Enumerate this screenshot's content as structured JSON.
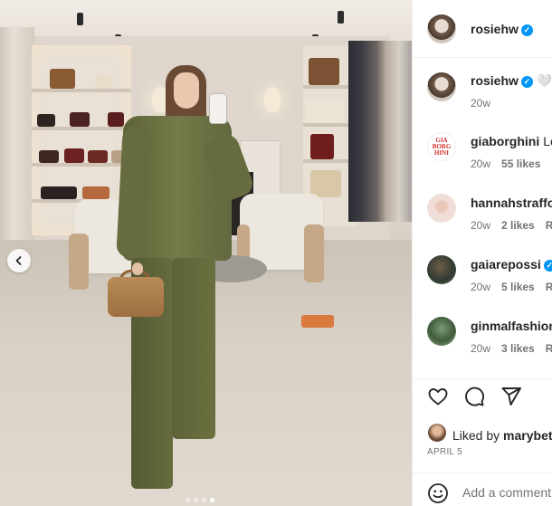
{
  "photo": {
    "alt": "",
    "carousel": {
      "count": 4,
      "active": 3
    }
  },
  "header": {
    "username": "rosiehw",
    "verified": true
  },
  "caption": {
    "username": "rosiehw",
    "verified": true,
    "text": "🤍🤍",
    "age": "20w"
  },
  "comments": [
    {
      "username": "giaborghini",
      "text": "Lo",
      "age": "20w",
      "likes": "55 likes",
      "reply": "R",
      "verified": false,
      "avatar_text": "GIA BORG HINI"
    },
    {
      "username": "hannahstraffo",
      "text": "",
      "age": "20w",
      "likes": "2 likes",
      "reply": "R",
      "verified": false
    },
    {
      "username": "gaiarepossi",
      "text": "",
      "age": "20w",
      "likes": "5 likes",
      "reply": "R",
      "verified": true
    },
    {
      "username": "ginmalfashion",
      "text": "",
      "age": "20w",
      "likes": "3 likes",
      "reply": "R",
      "verified": false
    }
  ],
  "actions": {
    "like_icon": "heart-icon",
    "comment_icon": "comment-bubble-icon",
    "share_icon": "paper-plane-icon"
  },
  "likes": {
    "prefix": "Liked by ",
    "user": "marybet"
  },
  "date": "APRIL 5",
  "comment_box": {
    "placeholder": "Add a comment",
    "emoji_icon": "smiley-icon"
  },
  "colors": {
    "verified": "#0095f6",
    "muted": "#737373",
    "text": "#262626"
  }
}
